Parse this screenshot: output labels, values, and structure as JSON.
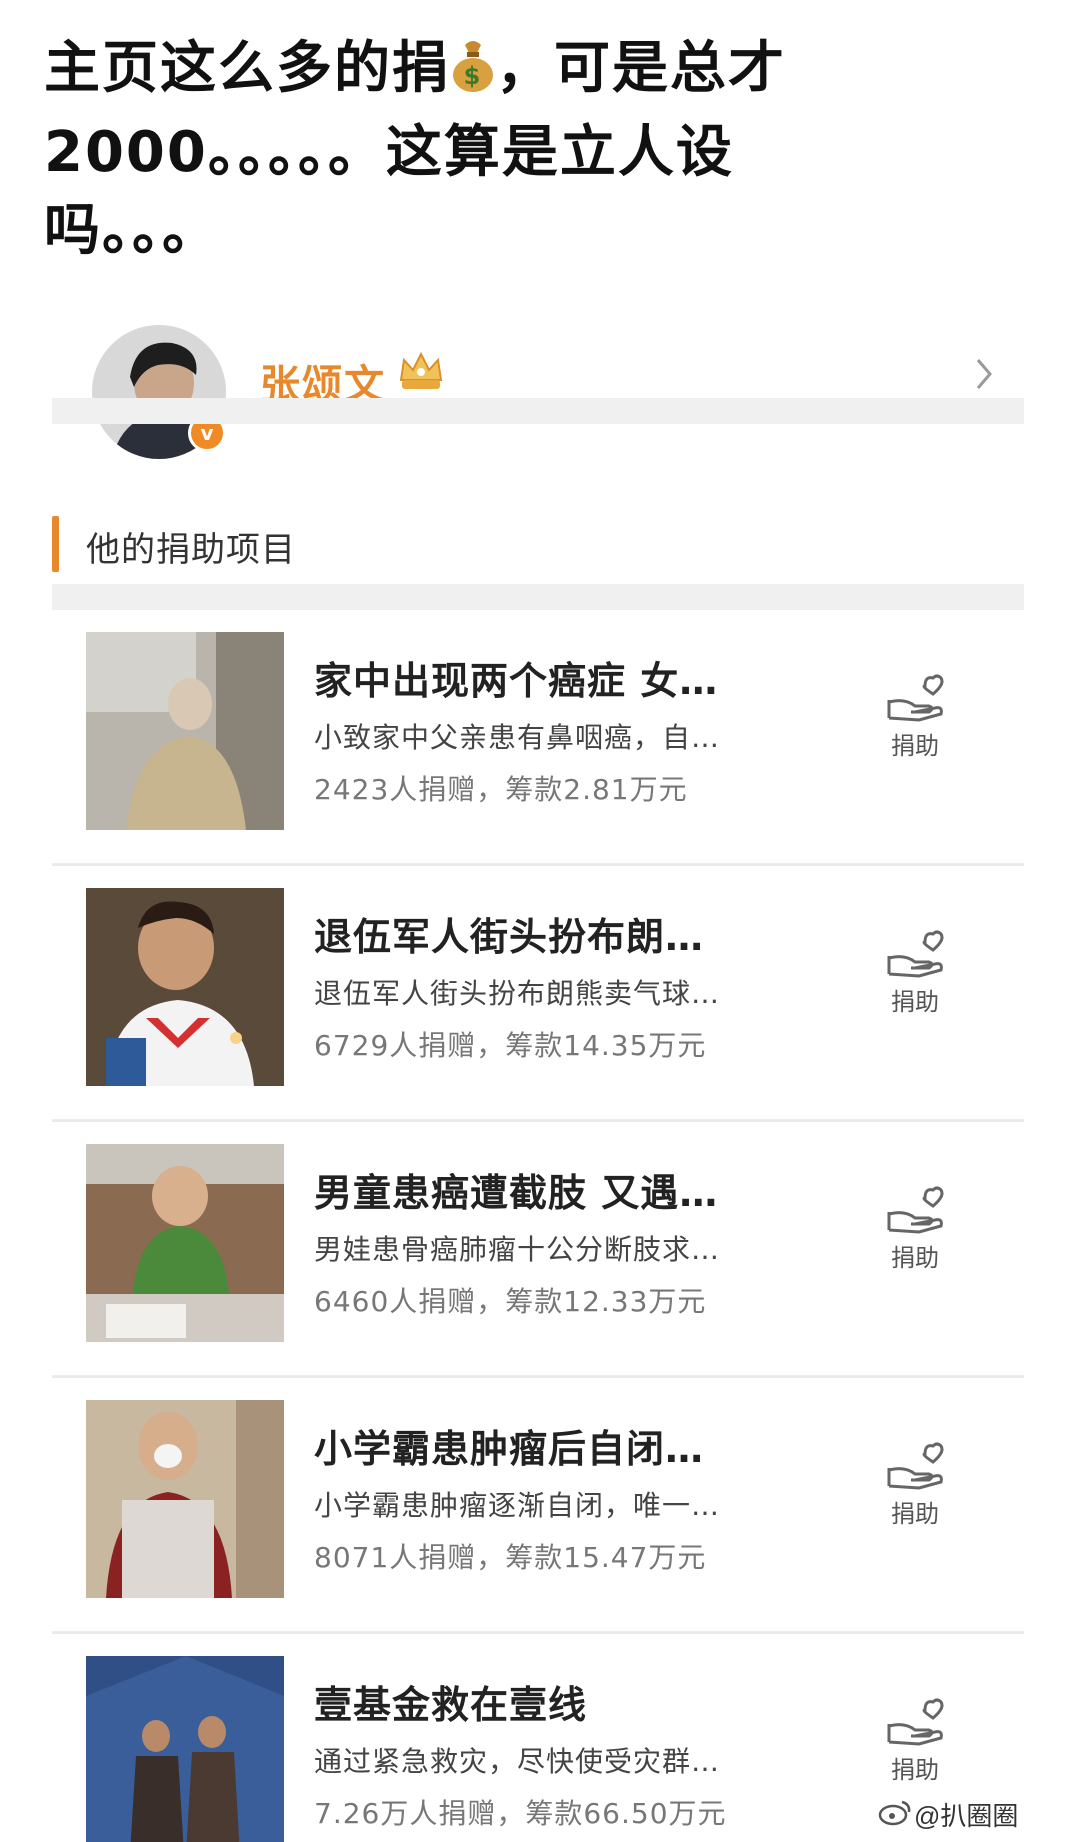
{
  "post": {
    "line1": "主页这么多的捐",
    "line1_end": "，可是总才",
    "line2": "2000。。。。。这算是立人设",
    "line3": "吗。。。",
    "bag_symbol": "$"
  },
  "profile": {
    "name": "张颂文",
    "verify_mark": "v"
  },
  "section": {
    "title": "他的捐助项目"
  },
  "donate_label": "捐助",
  "items": [
    {
      "title": "家中出现两个癌症 女…",
      "desc": "小致家中父亲患有鼻咽癌，自…",
      "stats": "2423人捐赠，筹款2.81万元"
    },
    {
      "title": "退伍军人街头扮布朗…",
      "desc": "退伍军人街头扮布朗熊卖气球…",
      "stats": "6729人捐赠，筹款14.35万元"
    },
    {
      "title": "男童患癌遭截肢 又遇…",
      "desc": "男娃患骨癌肺瘤十公分断肢求…",
      "stats": "6460人捐赠，筹款12.33万元"
    },
    {
      "title": "小学霸患肿瘤后自闭…",
      "desc": "小学霸患肿瘤逐渐自闭，唯一…",
      "stats": "8071人捐赠，筹款15.47万元"
    },
    {
      "title": "壹基金救在壹线",
      "desc": "通过紧急救灾，尽快使受灾群…",
      "stats": "7.26万人捐赠，筹款66.50万元"
    }
  ],
  "watermark": {
    "text": "@扒圈圈"
  },
  "colors": {
    "accent": "#e8882c",
    "band": "#f0f0f0"
  }
}
